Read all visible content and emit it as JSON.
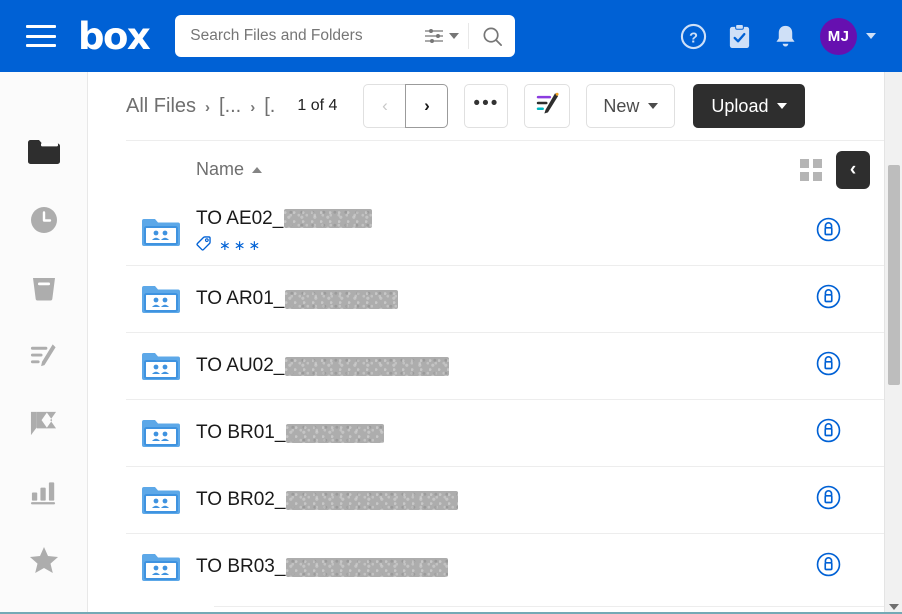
{
  "header": {
    "brand": "box",
    "menu_icon": "hamburger-icon",
    "search": {
      "placeholder": "Search Files and Folders",
      "value": ""
    },
    "help_icon": "help-circle-icon",
    "tasks_icon": "clipboard-check-icon",
    "notifications_icon": "bell-icon",
    "avatar_initials": "MJ",
    "accent_color": "#0061d5",
    "avatar_color": "#6610b0"
  },
  "sidebar": {
    "items": [
      {
        "icon": "folder-icon",
        "name": "all-files"
      },
      {
        "icon": "clock-icon",
        "name": "recents"
      },
      {
        "icon": "trash-icon",
        "name": "trash"
      },
      {
        "icon": "notes-pen-icon",
        "name": "notes"
      },
      {
        "icon": "relay-chevrons-icon",
        "name": "relay"
      },
      {
        "icon": "bar-chart-icon",
        "name": "insights"
      },
      {
        "icon": "star-icon",
        "name": "favorites"
      }
    ]
  },
  "toolbar": {
    "breadcrumbs": [
      "All Files",
      "[...",
      "[."
    ],
    "breadcrumb_separator": "›",
    "page_count": "1 of 4",
    "prev_label": "‹",
    "next_label": "›",
    "more_label": "•••",
    "notes_button_icon": "note-pen-icon",
    "new_label": "New",
    "upload_label": "Upload",
    "upload_color": "#2e2e2e"
  },
  "table": {
    "column_header": "Name",
    "sort_direction": "ascending",
    "grid_view_icon": "grid-view-icon",
    "collapse_icon": "chevron-left-icon",
    "rows": [
      {
        "prefix": "TO AE02_",
        "redacted_width": 88,
        "icon": "shared-folder-icon",
        "lock_icon": "lock-circle-icon",
        "tag_icon": "tag-icon",
        "tag_text": "∗∗∗"
      },
      {
        "prefix": "TO AR01_",
        "redacted_width": 113,
        "icon": "shared-folder-icon",
        "lock_icon": "lock-circle-icon"
      },
      {
        "prefix": "TO AU02_",
        "redacted_width": 164,
        "icon": "shared-folder-icon",
        "lock_icon": "lock-circle-icon"
      },
      {
        "prefix": "TO BR01_",
        "redacted_width": 98,
        "icon": "shared-folder-icon",
        "lock_icon": "lock-circle-icon"
      },
      {
        "prefix": "TO BR02_",
        "redacted_width": 172,
        "icon": "shared-folder-icon",
        "lock_icon": "lock-circle-icon"
      },
      {
        "prefix": "TO BR03_",
        "redacted_width": 162,
        "icon": "shared-folder-icon",
        "lock_icon": "lock-circle-icon"
      }
    ]
  }
}
